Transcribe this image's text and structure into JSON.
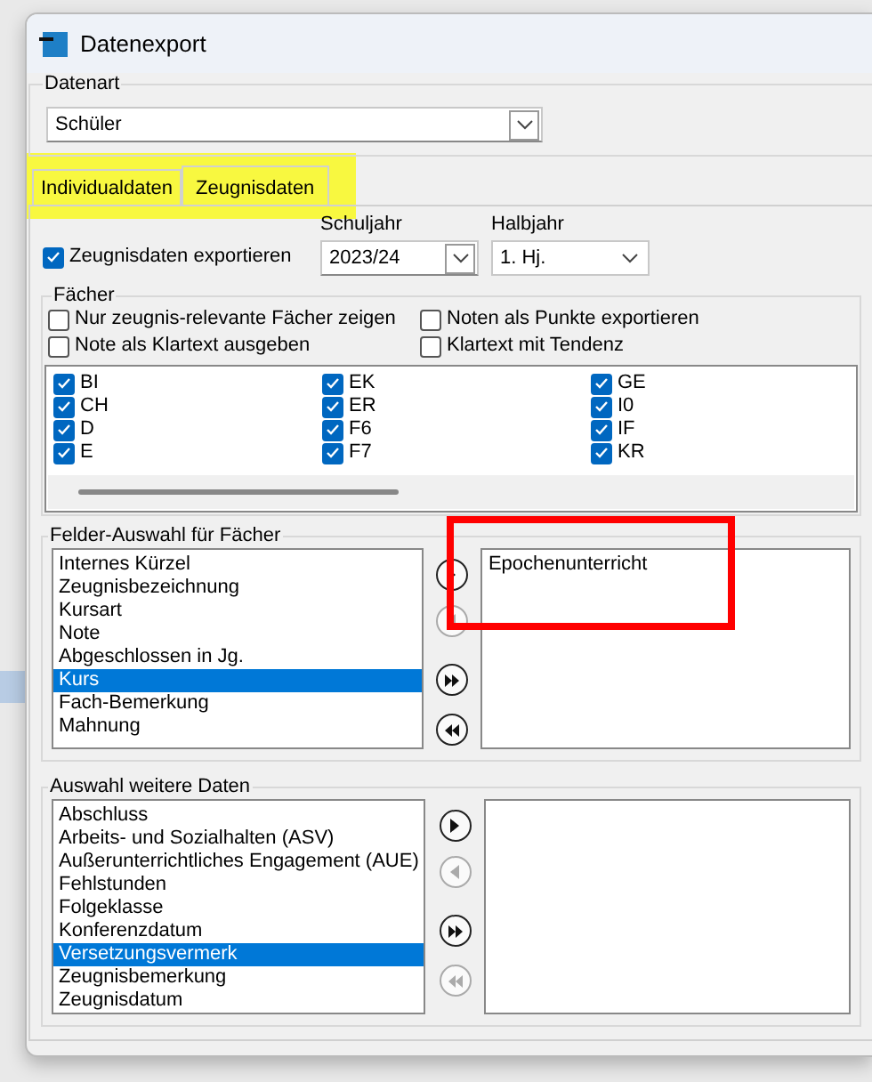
{
  "window": {
    "title": "Datenexport"
  },
  "datenart": {
    "label": "Datenart",
    "value": "Schüler"
  },
  "tabs": [
    {
      "label": "Individualdaten",
      "selected": false
    },
    {
      "label": "Zeugnisdaten",
      "selected": true
    }
  ],
  "export_checkbox": {
    "label": "Zeugnisdaten exportieren",
    "checked": true
  },
  "schuljahr": {
    "label": "Schuljahr",
    "value": "2023/24"
  },
  "halbjahr": {
    "label": "Halbjahr",
    "value": "1. Hj."
  },
  "faecher": {
    "label": "Fächer",
    "options": [
      {
        "label": "Nur zeugnis-relevante Fächer zeigen",
        "checked": false
      },
      {
        "label": "Noten als Punkte exportieren",
        "checked": false
      },
      {
        "label": "Note als Klartext ausgeben",
        "checked": false
      },
      {
        "label": "Klartext mit Tendenz",
        "checked": false
      }
    ],
    "subjects": [
      {
        "label": "BI",
        "checked": true
      },
      {
        "label": "CH",
        "checked": true
      },
      {
        "label": "D",
        "checked": true
      },
      {
        "label": "E",
        "checked": true
      },
      {
        "label": "EK",
        "checked": true
      },
      {
        "label": "ER",
        "checked": true
      },
      {
        "label": "F6",
        "checked": true
      },
      {
        "label": "F7",
        "checked": true
      },
      {
        "label": "GE",
        "checked": true
      },
      {
        "label": "I0",
        "checked": true
      },
      {
        "label": "IF",
        "checked": true
      },
      {
        "label": "KR",
        "checked": true
      }
    ]
  },
  "felder": {
    "label": "Felder-Auswahl für Fächer",
    "available": [
      {
        "label": "Internes Kürzel",
        "selected": false
      },
      {
        "label": "Zeugnisbezeichnung",
        "selected": false
      },
      {
        "label": "Kursart",
        "selected": false
      },
      {
        "label": "Note",
        "selected": false
      },
      {
        "label": "Abgeschlossen in Jg.",
        "selected": false
      },
      {
        "label": "Kurs",
        "selected": true
      },
      {
        "label": "Fach-Bemerkung",
        "selected": false
      },
      {
        "label": "Mahnung",
        "selected": false
      }
    ],
    "buttons": [
      {
        "kind": "add",
        "disabled": false
      },
      {
        "kind": "remove",
        "disabled": true
      },
      {
        "kind": "add-all",
        "disabled": false
      },
      {
        "kind": "remove-all",
        "disabled": false
      }
    ],
    "chosen": [
      {
        "label": "Epochenunterricht",
        "selected": false
      }
    ]
  },
  "weitere": {
    "label": "Auswahl weitere Daten",
    "available": [
      {
        "label": "Abschluss",
        "selected": false
      },
      {
        "label": "Arbeits- und Sozialhalten (ASV)",
        "selected": false
      },
      {
        "label": "Außerunterrichtliches Engagement (AUE)",
        "selected": false
      },
      {
        "label": "Fehlstunden",
        "selected": false
      },
      {
        "label": "Folgeklasse",
        "selected": false
      },
      {
        "label": "Konferenzdatum",
        "selected": false
      },
      {
        "label": "Versetzungsvermerk",
        "selected": true
      },
      {
        "label": "Zeugnisbemerkung",
        "selected": false
      },
      {
        "label": "Zeugnisdatum",
        "selected": false
      }
    ],
    "buttons": [
      {
        "kind": "add",
        "disabled": false
      },
      {
        "kind": "remove",
        "disabled": true
      },
      {
        "kind": "add-all",
        "disabled": false
      },
      {
        "kind": "remove-all",
        "disabled": true
      }
    ]
  },
  "annotations": [
    {
      "kind": "highlight"
    },
    {
      "kind": "frame"
    }
  ]
}
